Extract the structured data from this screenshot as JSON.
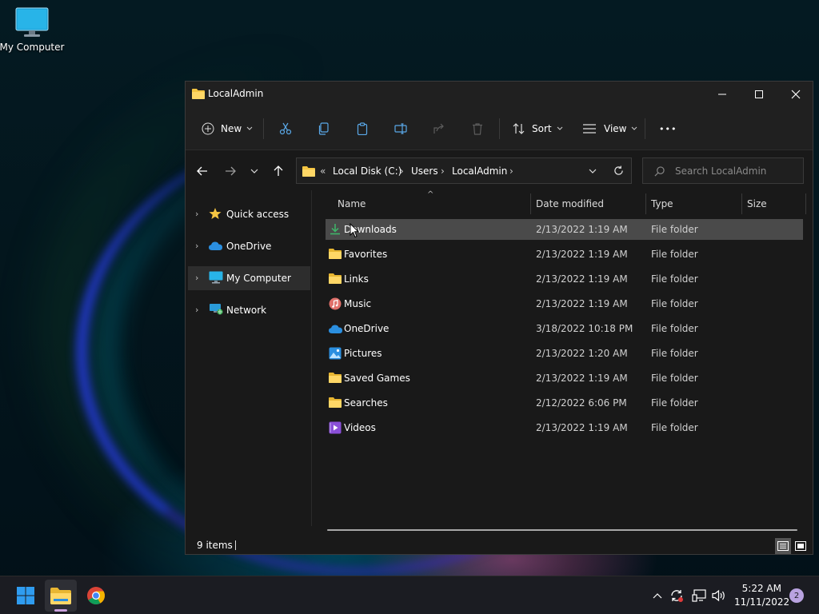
{
  "desktop": {
    "icon_label": "My Computer"
  },
  "window": {
    "title": "LocalAdmin",
    "controls": {
      "minimize": "—",
      "maximize": "☐",
      "close": "✕"
    }
  },
  "toolbar": {
    "new_label": "New",
    "sort_label": "Sort",
    "view_label": "View",
    "more_label": "•••"
  },
  "address": {
    "overflow": "«",
    "crumbs": [
      "Local Disk (C:)",
      "Users",
      "LocalAdmin"
    ],
    "separator": "›"
  },
  "search": {
    "placeholder": "Search LocalAdmin"
  },
  "sidebar": {
    "items": [
      {
        "label": "Quick access",
        "icon": "star-icon"
      },
      {
        "label": "OneDrive",
        "icon": "cloud-icon"
      },
      {
        "label": "My Computer",
        "icon": "computer-icon"
      },
      {
        "label": "Network",
        "icon": "network-icon"
      }
    ]
  },
  "columns": {
    "name": "Name",
    "date": "Date modified",
    "type": "Type",
    "size": "Size",
    "sort_indicator": "^"
  },
  "files": [
    {
      "name": "Downloads",
      "date": "2/13/2022 1:19 AM",
      "type": "File folder",
      "icon": "download-icon"
    },
    {
      "name": "Favorites",
      "date": "2/13/2022 1:19 AM",
      "type": "File folder",
      "icon": "folder-icon"
    },
    {
      "name": "Links",
      "date": "2/13/2022 1:19 AM",
      "type": "File folder",
      "icon": "folder-icon"
    },
    {
      "name": "Music",
      "date": "2/13/2022 1:19 AM",
      "type": "File folder",
      "icon": "music-icon"
    },
    {
      "name": "OneDrive",
      "date": "3/18/2022 10:18 PM",
      "type": "File folder",
      "icon": "cloud-icon"
    },
    {
      "name": "Pictures",
      "date": "2/13/2022 1:20 AM",
      "type": "File folder",
      "icon": "pictures-icon"
    },
    {
      "name": "Saved Games",
      "date": "2/13/2022 1:19 AM",
      "type": "File folder",
      "icon": "folder-icon"
    },
    {
      "name": "Searches",
      "date": "2/12/2022 6:06 PM",
      "type": "File folder",
      "icon": "folder-icon"
    },
    {
      "name": "Videos",
      "date": "2/13/2022 1:19 AM",
      "type": "File folder",
      "icon": "videos-icon"
    }
  ],
  "status": {
    "item_count": "9 items"
  },
  "taskbar": {
    "time": "5:22 AM",
    "date": "11/11/2022",
    "notification_count": "2"
  },
  "colors": {
    "window_bg": "#191919",
    "titlebar_bg": "#202020",
    "selected_row": "#4a4a4a",
    "folder_yellow": "#f5c542",
    "accent_blue": "#3a96dd"
  }
}
